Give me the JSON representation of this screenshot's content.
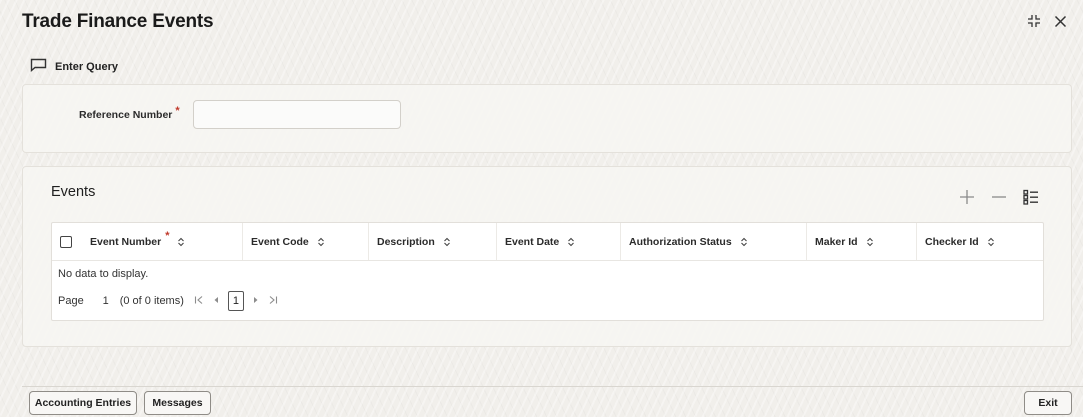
{
  "window": {
    "title": "Trade Finance Events"
  },
  "toolbar": {
    "enter_query_label": "Enter Query"
  },
  "query": {
    "reference_number_label": "Reference Number",
    "required_mark": "*",
    "reference_number_value": ""
  },
  "events": {
    "title": "Events",
    "columns": {
      "event_number": "Event Number",
      "event_code": "Event Code",
      "description": "Description",
      "event_date": "Event Date",
      "authorization_status": "Authorization Status",
      "maker_id": "Maker Id",
      "checker_id": "Checker Id"
    },
    "required_mark": "*",
    "empty_message": "No data to display.",
    "pagination": {
      "page_label": "Page",
      "page_value": "1",
      "info": "(0 of 0 items)",
      "current_page": "1"
    }
  },
  "footer": {
    "accounting_entries_label": "Accounting Entries",
    "messages_label": "Messages",
    "exit_label": "Exit"
  },
  "colors": {
    "required": "#c0392b",
    "background": "#f1efeb",
    "panel": "#f6f5f2"
  }
}
